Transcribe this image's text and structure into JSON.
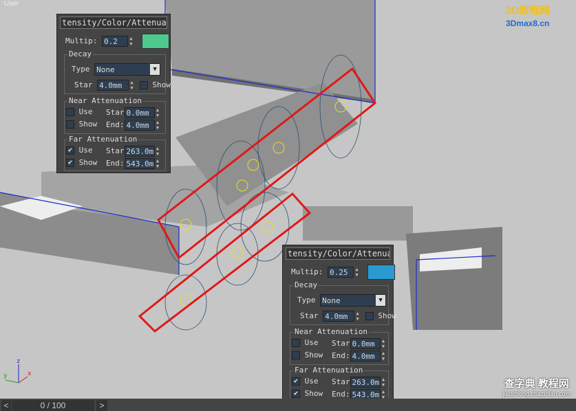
{
  "viewport": {
    "label": "User",
    "axis": {
      "x": "x",
      "y": "y",
      "z": "z"
    }
  },
  "logo": {
    "text1": "3D教程网",
    "text2": "3Dmax8.cn"
  },
  "watermark": {
    "line1": "查字典 教程网",
    "line2": "jiaocheng.chazidian.com"
  },
  "timeline": {
    "prev": "<",
    "frame": "0 / 100",
    "next": ">"
  },
  "panels": [
    {
      "title": "tensity/Color/Attenuati",
      "multiplier_label": "Multip:",
      "multiplier": "0.2",
      "color": "#4ec98e",
      "decay": {
        "label": "Decay",
        "type_label": "Type",
        "type": "None",
        "start_label": "Star",
        "start": "4.0mm",
        "show_label": "Show",
        "show": false
      },
      "near": {
        "label": "Near Attenuation",
        "use_label": "Use",
        "use": false,
        "show_label": "Show",
        "show": false,
        "start_label": "Star",
        "start": "0.0mm",
        "end_label": "End:",
        "end": "4.0mm"
      },
      "far": {
        "label": "Far Attenuation",
        "use_label": "Use",
        "use": true,
        "show_label": "Show",
        "show": true,
        "start_label": "Star",
        "start": "263.0m",
        "end_label": "End:",
        "end": "543.0m"
      }
    },
    {
      "title": "tensity/Color/Attenuati",
      "multiplier_label": "Multip:",
      "multiplier": "0.25",
      "color": "#2a9bd0",
      "decay": {
        "label": "Decay",
        "type_label": "Type",
        "type": "None",
        "start_label": "Star",
        "start": "4.0mm",
        "show_label": "Show",
        "show": false
      },
      "near": {
        "label": "Near Attenuation",
        "use_label": "Use",
        "use": false,
        "show_label": "Show",
        "show": false,
        "start_label": "Star",
        "start": "0.0mm",
        "end_label": "End:",
        "end": "4.0mm"
      },
      "far": {
        "label": "Far Attenuation",
        "use_label": "Use",
        "use": true,
        "show_label": "Show",
        "show": true,
        "start_label": "Star",
        "start": "263.0m",
        "end_label": "End:",
        "end": "543.0m"
      }
    }
  ]
}
